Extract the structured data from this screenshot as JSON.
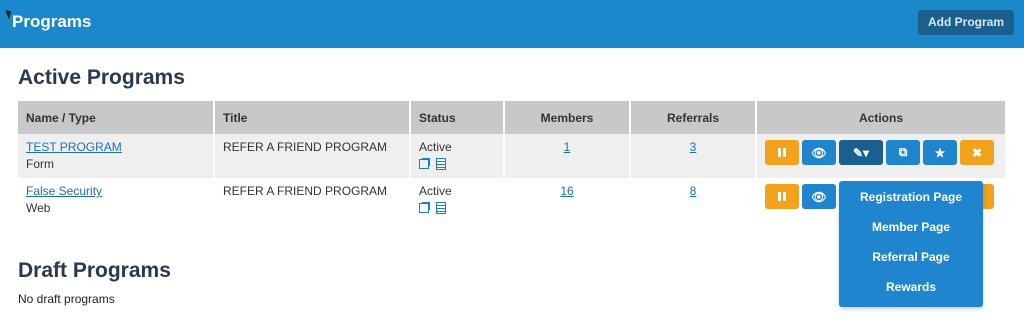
{
  "header": {
    "title": "Programs",
    "add_button": "Add Program"
  },
  "active_section": {
    "title": "Active Programs"
  },
  "table": {
    "columns": [
      "Name / Type",
      "Title",
      "Status",
      "Members",
      "Referrals",
      "Actions"
    ],
    "rows": [
      {
        "name": "TEST PROGRAM",
        "type": "Form",
        "title": "REFER A FRIEND PROGRAM",
        "status": "Active",
        "members": "1",
        "referrals": "3"
      },
      {
        "name": "False Security",
        "type": "Web",
        "title": "REFER A FRIEND PROGRAM",
        "status": "Active",
        "members": "16",
        "referrals": "8"
      }
    ]
  },
  "action_icons": {
    "pause": "pause-icon",
    "view": "eye-icon",
    "edit": "edit-dropdown-icon",
    "copy": "copy-icon",
    "star": "star-icon",
    "delete": "close-icon"
  },
  "dropdown": {
    "items": [
      "Registration Page",
      "Member Page",
      "Referral Page",
      "Rewards"
    ]
  },
  "draft_section": {
    "title": "Draft Programs",
    "empty_text": "No draft programs"
  },
  "colors": {
    "header": "#1b88cc",
    "orange": "#f3a21b",
    "blue": "#1f85cf",
    "dark_blue": "#1a5f8e"
  }
}
